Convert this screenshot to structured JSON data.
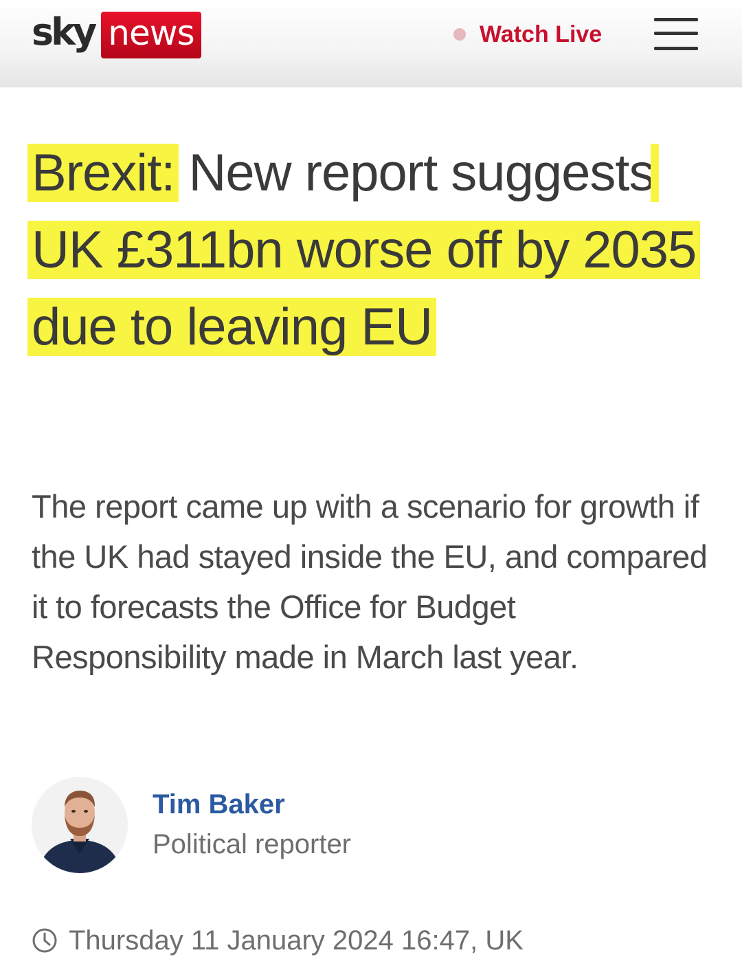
{
  "header": {
    "logo": {
      "brand": "sky",
      "product": "news"
    },
    "watch_live_label": "Watch Live",
    "menu_icon": "hamburger-menu-icon",
    "colors": {
      "brand_red": "#c8102e",
      "live_dot": "#e6b8bd"
    }
  },
  "article": {
    "headline": {
      "part1": "Brexit:",
      "part2": " New report suggests",
      "part3": " UK £311bn worse off by 2035 due to leaving EU",
      "highlight_color": "#f8f442"
    },
    "standfirst": "The report came up with a scenario for growth if the UK had stayed inside the EU, and compared it to forecasts the Office for Budget Responsibility made in March last year.",
    "author": {
      "name": "Tim Baker",
      "role": "Political reporter",
      "name_color": "#2c5aa0"
    },
    "timestamp": "Thursday 11 January 2024 16:47, UK",
    "timestamp_icon": "clock-icon"
  }
}
